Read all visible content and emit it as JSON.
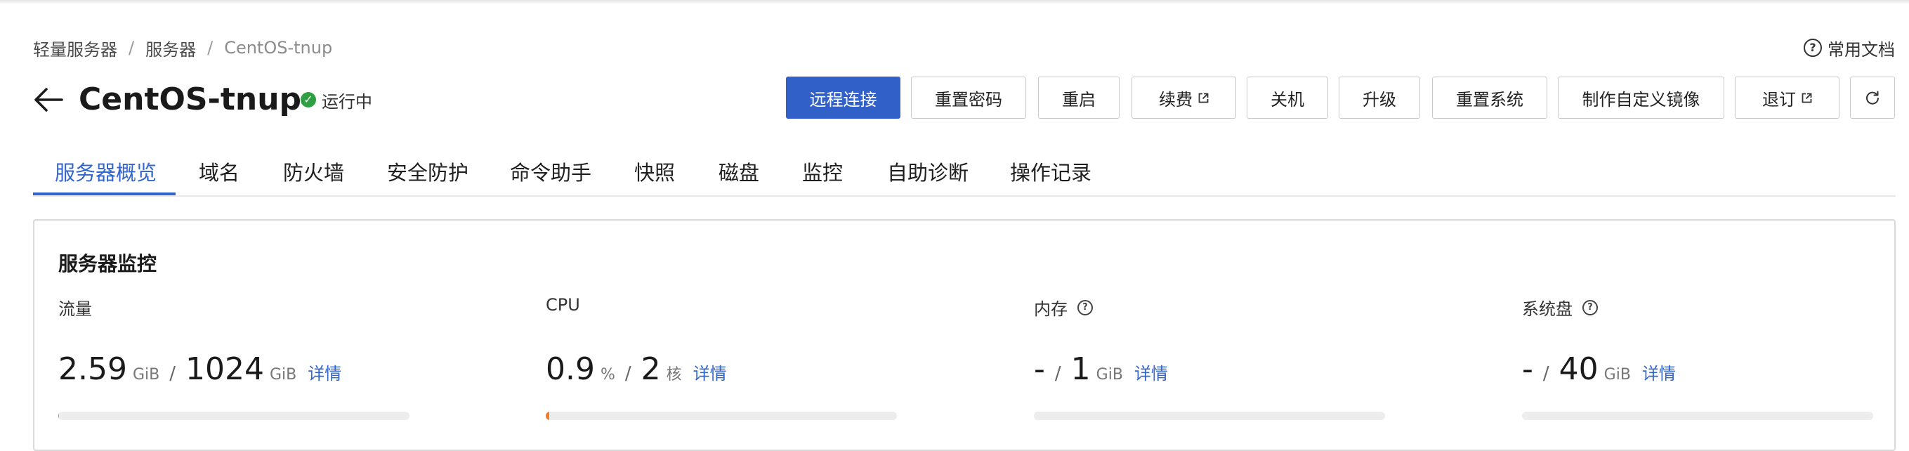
{
  "breadcrumb": [
    "轻量服务器",
    "服务器",
    "CentOS-tnup"
  ],
  "help": {
    "label": "常用文档",
    "icon": "question-circle-icon"
  },
  "header": {
    "title": "CentOS-tnup",
    "status": "运行中",
    "status_color": "#2ea043",
    "back_icon": "arrow-left-icon"
  },
  "actions": [
    {
      "label": "远程连接",
      "primary": true
    },
    {
      "label": "重置密码"
    },
    {
      "label": "重启"
    },
    {
      "label": "续费",
      "external": true
    },
    {
      "label": "关机"
    },
    {
      "label": "升级"
    },
    {
      "label": "重置系统"
    },
    {
      "label": "制作自定义镜像"
    },
    {
      "label": "退订",
      "external": true
    },
    {
      "label": "",
      "icon": "refresh-icon"
    }
  ],
  "tabs": [
    "服务器概览",
    "域名",
    "防火墙",
    "安全防护",
    "命令助手",
    "快照",
    "磁盘",
    "监控",
    "自助诊断",
    "操作记录"
  ],
  "active_tab": "服务器概览",
  "monitor": {
    "title": "服务器监控",
    "detail_label": "详情",
    "metrics": [
      {
        "label": "流量",
        "used": "2.59",
        "used_unit": "GiB",
        "total": "1024",
        "total_unit": "GiB",
        "percent": 0.25
      },
      {
        "label": "CPU",
        "used": "0.9",
        "used_unit": "%",
        "total": "2",
        "total_unit": "核",
        "percent": 0.9
      },
      {
        "label": "内存",
        "used": "-",
        "used_unit": "",
        "total": "1",
        "total_unit": "GiB",
        "help": true,
        "percent": 0
      },
      {
        "label": "系统盘",
        "used": "-",
        "used_unit": "",
        "total": "40",
        "total_unit": "GiB",
        "help": true,
        "percent": 0
      }
    ]
  },
  "colors": {
    "accent": "#3366cc",
    "primary_button": "#3060c8",
    "progress": "#f07c28"
  }
}
